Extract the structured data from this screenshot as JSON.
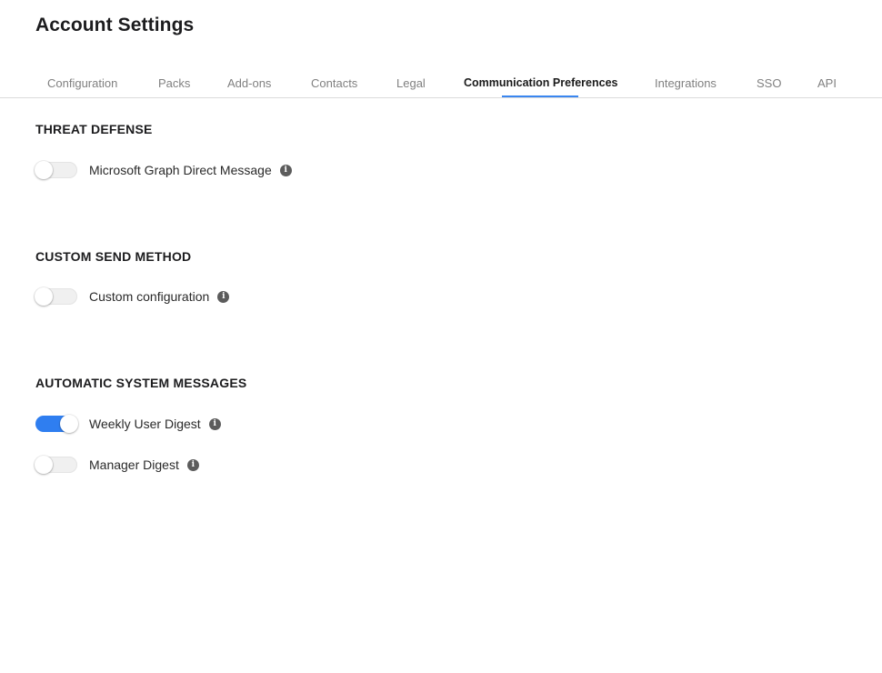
{
  "page": {
    "title": "Account Settings"
  },
  "tabs": [
    {
      "label": "Configuration",
      "active": false
    },
    {
      "label": "Packs",
      "active": false
    },
    {
      "label": "Add-ons",
      "active": false
    },
    {
      "label": "Contacts",
      "active": false
    },
    {
      "label": "Legal",
      "active": false
    },
    {
      "label": "Communication Preferences",
      "active": true
    },
    {
      "label": "Integrations",
      "active": false
    },
    {
      "label": "SSO",
      "active": false
    },
    {
      "label": "API",
      "active": false
    }
  ],
  "sections": [
    {
      "title": "THREAT DEFENSE",
      "items": [
        {
          "label": "Microsoft Graph Direct Message",
          "enabled": false
        }
      ]
    },
    {
      "title": "CUSTOM SEND METHOD",
      "items": [
        {
          "label": "Custom configuration",
          "enabled": false
        }
      ]
    },
    {
      "title": "AUTOMATIC SYSTEM MESSAGES",
      "items": [
        {
          "label": "Weekly User Digest",
          "enabled": true
        },
        {
          "label": "Manager Digest",
          "enabled": false
        }
      ]
    }
  ],
  "icons": {
    "info": "info-icon"
  },
  "colors": {
    "accent": "#2f7ef0",
    "tab_underline": "#3a86f0",
    "toggle_off": "#f0f0f0",
    "info_icon": "#5c5c5c"
  }
}
